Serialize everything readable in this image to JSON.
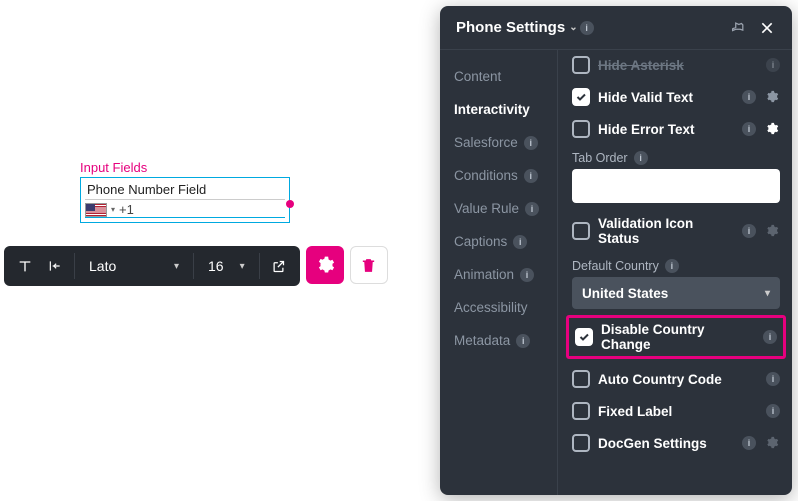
{
  "canvas": {
    "group_label": "Input Fields",
    "phone_field_label": "Phone Number Field",
    "dial_prefix": "+1"
  },
  "toolbar": {
    "font_family": "Lato",
    "font_size": "16"
  },
  "panel": {
    "title": "Phone Settings",
    "tabs": {
      "content": "Content",
      "interactivity": "Interactivity",
      "salesforce": "Salesforce",
      "conditions": "Conditions",
      "value_rule": "Value Rule",
      "captions": "Captions",
      "animation": "Animation",
      "accessibility": "Accessibility",
      "metadata": "Metadata"
    },
    "rows": {
      "hide_asterisk": "Hide Asterisk",
      "hide_valid_text": "Hide Valid Text",
      "hide_error_text": "Hide Error Text",
      "tab_order": "Tab Order",
      "validation_icon_status": "Validation Icon Status",
      "default_country": "Default Country",
      "default_country_value": "United States",
      "disable_country_change": "Disable Country Change",
      "auto_country_code": "Auto Country Code",
      "fixed_label": "Fixed Label",
      "docgen_settings": "DocGen Settings"
    }
  }
}
